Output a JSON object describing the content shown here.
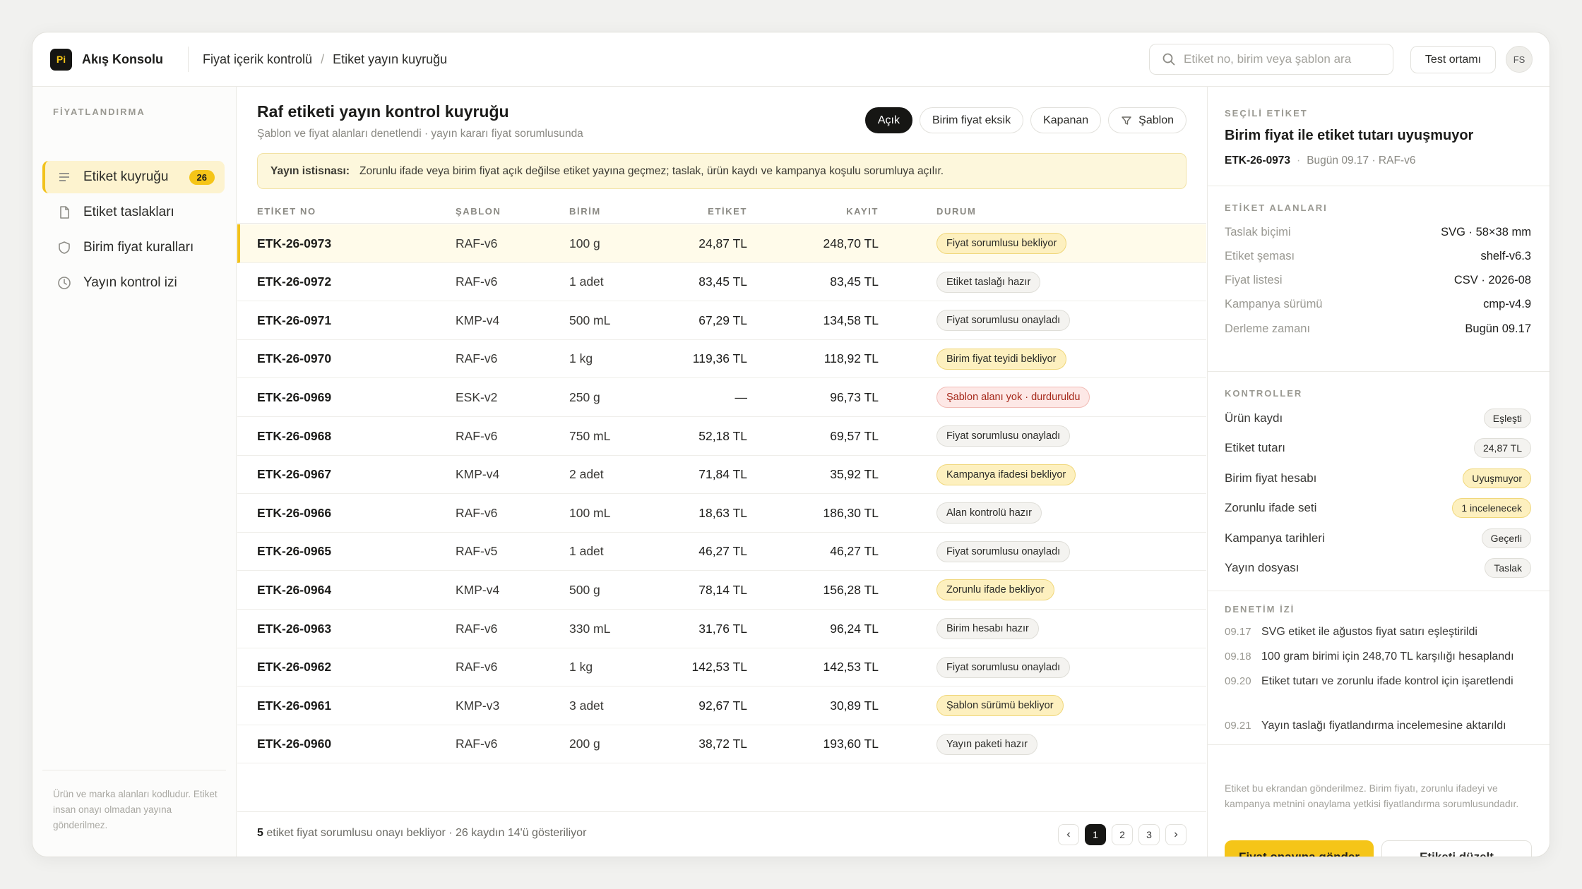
{
  "app": {
    "logo": "Pi",
    "name": "Akış Konsolu"
  },
  "breadcrumb": [
    "Fiyat içerik kontrolü",
    "Etiket yayın kuyruğu"
  ],
  "search": {
    "placeholder": "Etiket no, birim veya şablon ara"
  },
  "env_button": "Test ortamı",
  "avatar": "FS",
  "sidebar": {
    "title": "FİYATLANDIRMA",
    "items": [
      {
        "label": "Etiket kuyruğu",
        "badge": "26",
        "icon": "list-icon"
      },
      {
        "label": "Etiket taslakları",
        "icon": "file-icon"
      },
      {
        "label": "Birim fiyat kuralları",
        "icon": "shield-icon"
      },
      {
        "label": "Yayın kontrol izi",
        "icon": "clock-icon"
      }
    ],
    "footer": "Ürün ve marka alanları kodludur. Etiket insan onayı olmadan yayına gönderilmez."
  },
  "main": {
    "title": "Raf etiketi yayın kontrol kuyruğu",
    "subtitle": "Şablon ve fiyat alanları denetlendi · yayın kararı fiyat sorumlusunda",
    "filters": [
      "Açık",
      "Birim fiyat eksik",
      "Kapanan",
      "Şablon"
    ],
    "notice_label": "Yayın istisnası:",
    "notice_text": "Zorunlu ifade veya birim fiyat açık değilse etiket yayına geçmez; taslak, ürün kaydı ve kampanya koşulu sorumluya açılır.",
    "columns": [
      "ETİKET NO",
      "ŞABLON",
      "BİRİM",
      "ETİKET",
      "KAYIT",
      "DURUM"
    ],
    "rows": [
      {
        "no": "ETK-26-0973",
        "tpl": "RAF-v6",
        "unit": "100 g",
        "label": "24,87 TL",
        "rec": "248,70 TL",
        "status": "Fiyat sorumlusu bekliyor",
        "tone": "y"
      },
      {
        "no": "ETK-26-0972",
        "tpl": "RAF-v6",
        "unit": "1 adet",
        "label": "83,45 TL",
        "rec": "83,45 TL",
        "status": "Etiket taslağı hazır",
        "tone": "n"
      },
      {
        "no": "ETK-26-0971",
        "tpl": "KMP-v4",
        "unit": "500 mL",
        "label": "67,29 TL",
        "rec": "134,58 TL",
        "status": "Fiyat sorumlusu onayladı",
        "tone": "n"
      },
      {
        "no": "ETK-26-0970",
        "tpl": "RAF-v6",
        "unit": "1 kg",
        "label": "119,36 TL",
        "rec": "118,92 TL",
        "status": "Birim fiyat teyidi bekliyor",
        "tone": "y"
      },
      {
        "no": "ETK-26-0969",
        "tpl": "ESK-v2",
        "unit": "250 g",
        "label": "—",
        "rec": "96,73 TL",
        "status": "Şablon alanı yok · durduruldu",
        "tone": "r"
      },
      {
        "no": "ETK-26-0968",
        "tpl": "RAF-v6",
        "unit": "750 mL",
        "label": "52,18 TL",
        "rec": "69,57 TL",
        "status": "Fiyat sorumlusu onayladı",
        "tone": "n"
      },
      {
        "no": "ETK-26-0967",
        "tpl": "KMP-v4",
        "unit": "2 adet",
        "label": "71,84 TL",
        "rec": "35,92 TL",
        "status": "Kampanya ifadesi bekliyor",
        "tone": "y"
      },
      {
        "no": "ETK-26-0966",
        "tpl": "RAF-v6",
        "unit": "100 mL",
        "label": "18,63 TL",
        "rec": "186,30 TL",
        "status": "Alan kontrolü hazır",
        "tone": "n"
      },
      {
        "no": "ETK-26-0965",
        "tpl": "RAF-v5",
        "unit": "1 adet",
        "label": "46,27 TL",
        "rec": "46,27 TL",
        "status": "Fiyat sorumlusu onayladı",
        "tone": "n"
      },
      {
        "no": "ETK-26-0964",
        "tpl": "KMP-v4",
        "unit": "500 g",
        "label": "78,14 TL",
        "rec": "156,28 TL",
        "status": "Zorunlu ifade bekliyor",
        "tone": "y"
      },
      {
        "no": "ETK-26-0963",
        "tpl": "RAF-v6",
        "unit": "330 mL",
        "label": "31,76 TL",
        "rec": "96,24 TL",
        "status": "Birim hesabı hazır",
        "tone": "n"
      },
      {
        "no": "ETK-26-0962",
        "tpl": "RAF-v6",
        "unit": "1 kg",
        "label": "142,53 TL",
        "rec": "142,53 TL",
        "status": "Fiyat sorumlusu onayladı",
        "tone": "n"
      },
      {
        "no": "ETK-26-0961",
        "tpl": "KMP-v3",
        "unit": "3 adet",
        "label": "92,67 TL",
        "rec": "30,89 TL",
        "status": "Şablon sürümü bekliyor",
        "tone": "y"
      },
      {
        "no": "ETK-26-0960",
        "tpl": "RAF-v6",
        "unit": "200 g",
        "label": "38,72 TL",
        "rec": "193,60 TL",
        "status": "Yayın paketi hazır",
        "tone": "n"
      }
    ],
    "footer_count": "5",
    "footer_text": " etiket fiyat sorumlusu onayı bekliyor · 26 kaydın 14'ü gösteriliyor",
    "pages": [
      "1",
      "2",
      "3"
    ]
  },
  "detail": {
    "section_label": "SEÇİLİ ETİKET",
    "title": "Birim fiyat ile etiket tutarı uyuşmuyor",
    "id": "ETK-26-0973",
    "meta": "Bugün 09.17 · RAF-v6",
    "fields_title": "ETİKET ALANLARI",
    "fields": [
      {
        "k": "Taslak biçimi",
        "v": "SVG · 58×38 mm"
      },
      {
        "k": "Etiket şeması",
        "v": "shelf-v6.3"
      },
      {
        "k": "Fiyat listesi",
        "v": "CSV · 2026-08"
      },
      {
        "k": "Kampanya sürümü",
        "v": "cmp-v4.9"
      },
      {
        "k": "Derleme zamanı",
        "v": "Bugün 09.17"
      }
    ],
    "checks_title": "KONTROLLER",
    "checks": [
      {
        "k": "Ürün kaydı",
        "v": "Eşleşti",
        "tone": "n"
      },
      {
        "k": "Etiket tutarı",
        "v": "24,87 TL",
        "tone": "n"
      },
      {
        "k": "Birim fiyat hesabı",
        "v": "Uyuşmuyor",
        "tone": "y"
      },
      {
        "k": "Zorunlu ifade seti",
        "v": "1 incelenecek",
        "tone": "y"
      },
      {
        "k": "Kampanya tarihleri",
        "v": "Geçerli",
        "tone": "n"
      },
      {
        "k": "Yayın dosyası",
        "v": "Taslak",
        "tone": "n"
      }
    ],
    "log_title": "DENETİM İZİ",
    "log": [
      {
        "t": "09.17",
        "m": "SVG etiket ile ağustos fiyat satırı eşleştirildi"
      },
      {
        "t": "09.18",
        "m": "100 gram birimi için 248,70 TL karşılığı hesaplandı"
      },
      {
        "t": "09.20",
        "m": "Etiket tutarı ve zorunlu ifade kontrol için işaretlendi"
      },
      {
        "t": "09.21",
        "m": "Yayın taslağı fiyatlandırma incelemesine aktarıldı"
      }
    ],
    "note": "Etiket bu ekrandan gönderilmez. Birim fiyatı, zorunlu ifadeyi ve kampanya metnini onaylama yetkisi fiyatlandırma sorumlusundadır.",
    "primary_button": "Fiyat onayına gönder",
    "secondary_button": "Etiketi düzelt"
  },
  "colors": {
    "accent": "#f5c518",
    "dark": "#161614",
    "warn_bg": "#fdf0bf",
    "error": "#a52719"
  }
}
